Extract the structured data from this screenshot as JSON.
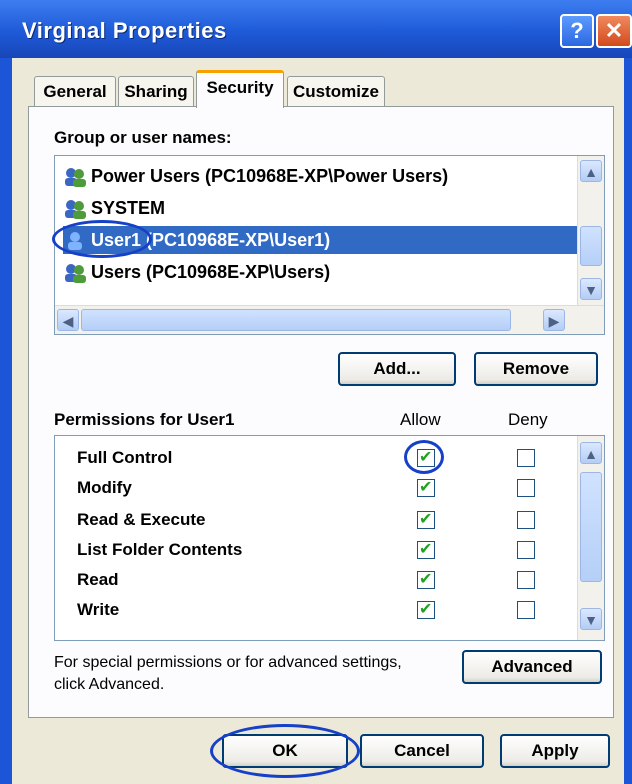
{
  "window": {
    "title": "Virginal Properties"
  },
  "tabs": [
    "General",
    "Sharing",
    "Security",
    "Customize"
  ],
  "groups": {
    "label": "Group or user names:",
    "items": [
      "Power Users (PC10968E-XP\\Power Users)",
      "SYSTEM",
      "User1 (PC10968E-XP\\User1)",
      "Users (PC10968E-XP\\Users)"
    ],
    "selected_index": 2
  },
  "buttons": {
    "add": "Add...",
    "remove": "Remove",
    "advanced": "Advanced",
    "ok": "OK",
    "cancel": "Cancel",
    "apply": "Apply"
  },
  "permissions": {
    "label": "Permissions for User1",
    "allow_header": "Allow",
    "deny_header": "Deny",
    "rows": [
      {
        "name": "Full Control",
        "allow": true,
        "deny": false
      },
      {
        "name": "Modify",
        "allow": true,
        "deny": false
      },
      {
        "name": "Read & Execute",
        "allow": true,
        "deny": false
      },
      {
        "name": "List Folder Contents",
        "allow": true,
        "deny": false
      },
      {
        "name": "Read",
        "allow": true,
        "deny": false
      },
      {
        "name": "Write",
        "allow": true,
        "deny": false
      }
    ]
  },
  "advanced_note": {
    "line1": "For special permissions or for advanced settings,",
    "line2": "click Advanced."
  },
  "colors": {
    "selection": "#316ac5",
    "titlebar": "#1e5ad8",
    "highlight_ring": "#1640c8"
  }
}
